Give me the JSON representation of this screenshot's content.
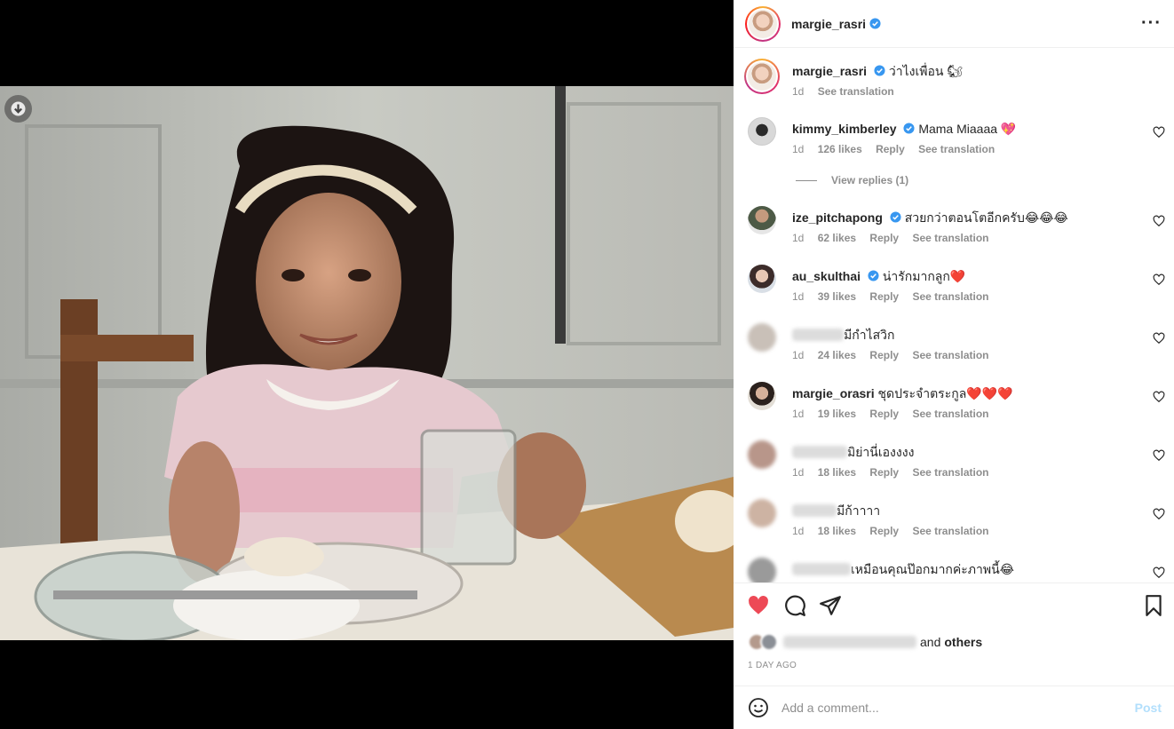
{
  "post": {
    "author": "margie_rasri",
    "caption": "ว่าไงเพื่อน 🐿",
    "caption_age": "1d",
    "see_translation": "See translation"
  },
  "comments": [
    {
      "user": "kimmy_kimberley",
      "verified": true,
      "text": "Mama Miaaaa 💖",
      "age": "1d",
      "likes": "126 likes",
      "reply": "Reply",
      "translate": "See translation",
      "view_replies": "View replies (1)"
    },
    {
      "user": "ize_pitchapong",
      "verified": true,
      "text": "สวยกว่าตอนโตอีกครับ😂😂😂",
      "age": "1d",
      "likes": "62 likes",
      "reply": "Reply",
      "translate": "See translation"
    },
    {
      "user": "au_skulthai",
      "verified": true,
      "text": "น่ารักมากลูก❤️",
      "age": "1d",
      "likes": "39 likes",
      "reply": "Reply",
      "translate": "See translation"
    },
    {
      "user": "",
      "verified": false,
      "text": "มีกำไสวิก",
      "age": "1d",
      "likes": "24 likes",
      "reply": "Reply",
      "translate": "See translation"
    },
    {
      "user": "margie_orasri",
      "verified": false,
      "text": "ชุดประจำตระกูล❤️❤️❤️",
      "age": "1d",
      "likes": "19 likes",
      "reply": "Reply",
      "translate": "See translation"
    },
    {
      "user": "",
      "verified": false,
      "text": "มิย่านี่เองงงง",
      "age": "1d",
      "likes": "18 likes",
      "reply": "Reply",
      "translate": "See translation"
    },
    {
      "user": "",
      "verified": false,
      "text": "มีก้าาาา",
      "age": "1d",
      "likes": "18 likes",
      "reply": "Reply",
      "translate": "See translation"
    },
    {
      "user": "",
      "verified": false,
      "text": "เหมือนคุณป๊อกมากค่ะภาพนี้😂"
    }
  ],
  "likes_summary": {
    "suffix_and": "and",
    "suffix_others": "others"
  },
  "timestamp": "1 DAY AGO",
  "add_comment": {
    "placeholder": "Add a comment...",
    "post_label": "Post"
  },
  "colors": {
    "like_active": "#ed4956",
    "verified": "#3897f0",
    "post_disabled": "#b2dffc"
  }
}
